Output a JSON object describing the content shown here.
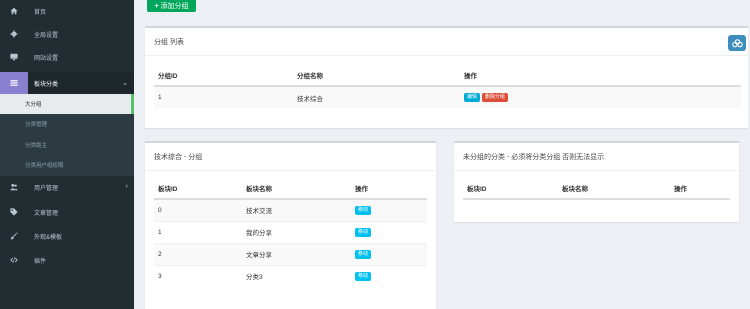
{
  "sidebar": {
    "items": [
      {
        "label": "首页",
        "icon": "home-icon"
      },
      {
        "label": "全局设置",
        "icon": "gear-icon"
      },
      {
        "label": "网站设置",
        "icon": "monitor-icon"
      },
      {
        "label": "板块分类",
        "icon": "list-icon",
        "active": true
      },
      {
        "label": "用户管理",
        "icon": "users-icon"
      },
      {
        "label": "文章管理",
        "icon": "tag-icon"
      },
      {
        "label": "外观&模板",
        "icon": "brush-icon"
      },
      {
        "label": "插件",
        "icon": "code-icon"
      }
    ],
    "submenu": [
      {
        "label": "大分组",
        "active": true
      },
      {
        "label": "分类管理"
      },
      {
        "label": "分类版主"
      },
      {
        "label": "分类用户组权限"
      }
    ]
  },
  "toolbar": {
    "add_group_label": "添加分组"
  },
  "group_list": {
    "title": "分组 列表",
    "columns": [
      "分组ID",
      "分组名称",
      "操作"
    ],
    "rows": [
      {
        "id": "1",
        "name": "技术综合",
        "edit_label": "编辑",
        "delete_label": "删除分组"
      }
    ]
  },
  "group_detail": {
    "title": "技术综合 - 分组",
    "columns": [
      "板块ID",
      "板块名称",
      "操作"
    ],
    "rows": [
      {
        "id": "0",
        "name": "技术交流",
        "action_label": "移动"
      },
      {
        "id": "1",
        "name": "我的分享",
        "action_label": "移动"
      },
      {
        "id": "2",
        "name": "文章分享",
        "action_label": "移动"
      },
      {
        "id": "3",
        "name": "分类3",
        "action_label": "移动"
      }
    ]
  },
  "ungrouped": {
    "title": "未分组的分类 - 必须将分类分组 否则无法显示",
    "columns": [
      "板块ID",
      "板块名称",
      "操作"
    ]
  },
  "colors": {
    "sidebar_bg": "#222d32",
    "accent_active": "#8a80d0",
    "success": "#00a65a",
    "info": "#00c0ef",
    "danger": "#dd4b39"
  }
}
